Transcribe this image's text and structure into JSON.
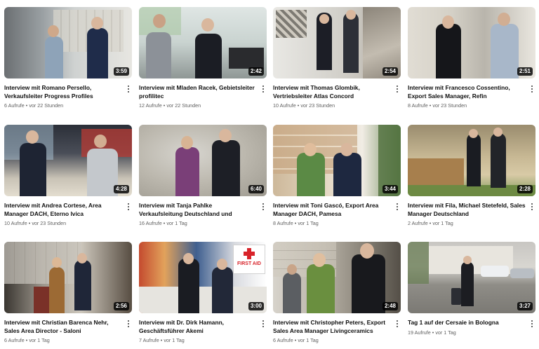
{
  "videos": [
    {
      "title": "Interview mit Romano Persello, Verkaufsleiter Progress Profiles",
      "duration": "3:59",
      "views": "6 Aufrufe",
      "age": "vor 22 Stunden"
    },
    {
      "title": "Interview mit Mladen Racek, Gebietsleiter profilitec",
      "duration": "2:42",
      "views": "12 Aufrufe",
      "age": "vor 22 Stunden"
    },
    {
      "title": "Interview mit Thomas Glombik, Vertriebsleiter Atlas Concord",
      "duration": "2:54",
      "views": "10 Aufrufe",
      "age": "vor 23 Stunden"
    },
    {
      "title": "Interview mit Francesco Cossentino, Export Sales Manager, Refin",
      "duration": "2:51",
      "views": "8 Aufrufe",
      "age": "vor 23 Stunden"
    },
    {
      "title": "Interview mit Andrea Cortese, Area Manager DACH, Eterno Ivica",
      "duration": "4:28",
      "views": "10 Aufrufe",
      "age": "vor 23 Stunden"
    },
    {
      "title": "Interview mit Tanja Pahlke Verkaufsleitung Deutschland und Österreich ICG Gruppe…",
      "duration": "6:40",
      "views": "16 Aufrufe",
      "age": "vor 1 Tag"
    },
    {
      "title": "Interview mit Toni Gascó, Export Area Manager DACH, Pamesa",
      "duration": "3:44",
      "views": "8 Aufrufe",
      "age": "vor 1 Tag"
    },
    {
      "title": "Interview mit Fila, Michael Stetefeld, Sales Manager Deutschland",
      "duration": "2:28",
      "views": "2 Aufrufe",
      "age": "vor 1 Tag"
    },
    {
      "title": "Interview mit Christian Barenca Nehr, Sales Area Director - Saloni",
      "duration": "2:56",
      "views": "6 Aufrufe",
      "age": "vor 1 Tag"
    },
    {
      "title": "Interview mit Dr. Dirk Hamann, Geschäftsführer Akemi",
      "duration": "3:00",
      "views": "7 Aufrufe",
      "age": "vor 1 Tag",
      "sign_text": "FIRST AID"
    },
    {
      "title": "Interview mit Christopher Peters, Export Sales Area Manager Livingceramics",
      "duration": "2:48",
      "views": "6 Aufrufe",
      "age": "vor 1 Tag"
    },
    {
      "title": "Tag 1 auf der Cersaie in Bologna",
      "duration": "3:27",
      "views": "19 Aufrufe",
      "age": "vor 1 Tag"
    }
  ],
  "meta_separator": "•",
  "icons": {
    "menu": "more-vert-icon"
  },
  "colors": {
    "title": "#0f0f0f",
    "meta": "#606060",
    "duration_bg": "#000000"
  }
}
